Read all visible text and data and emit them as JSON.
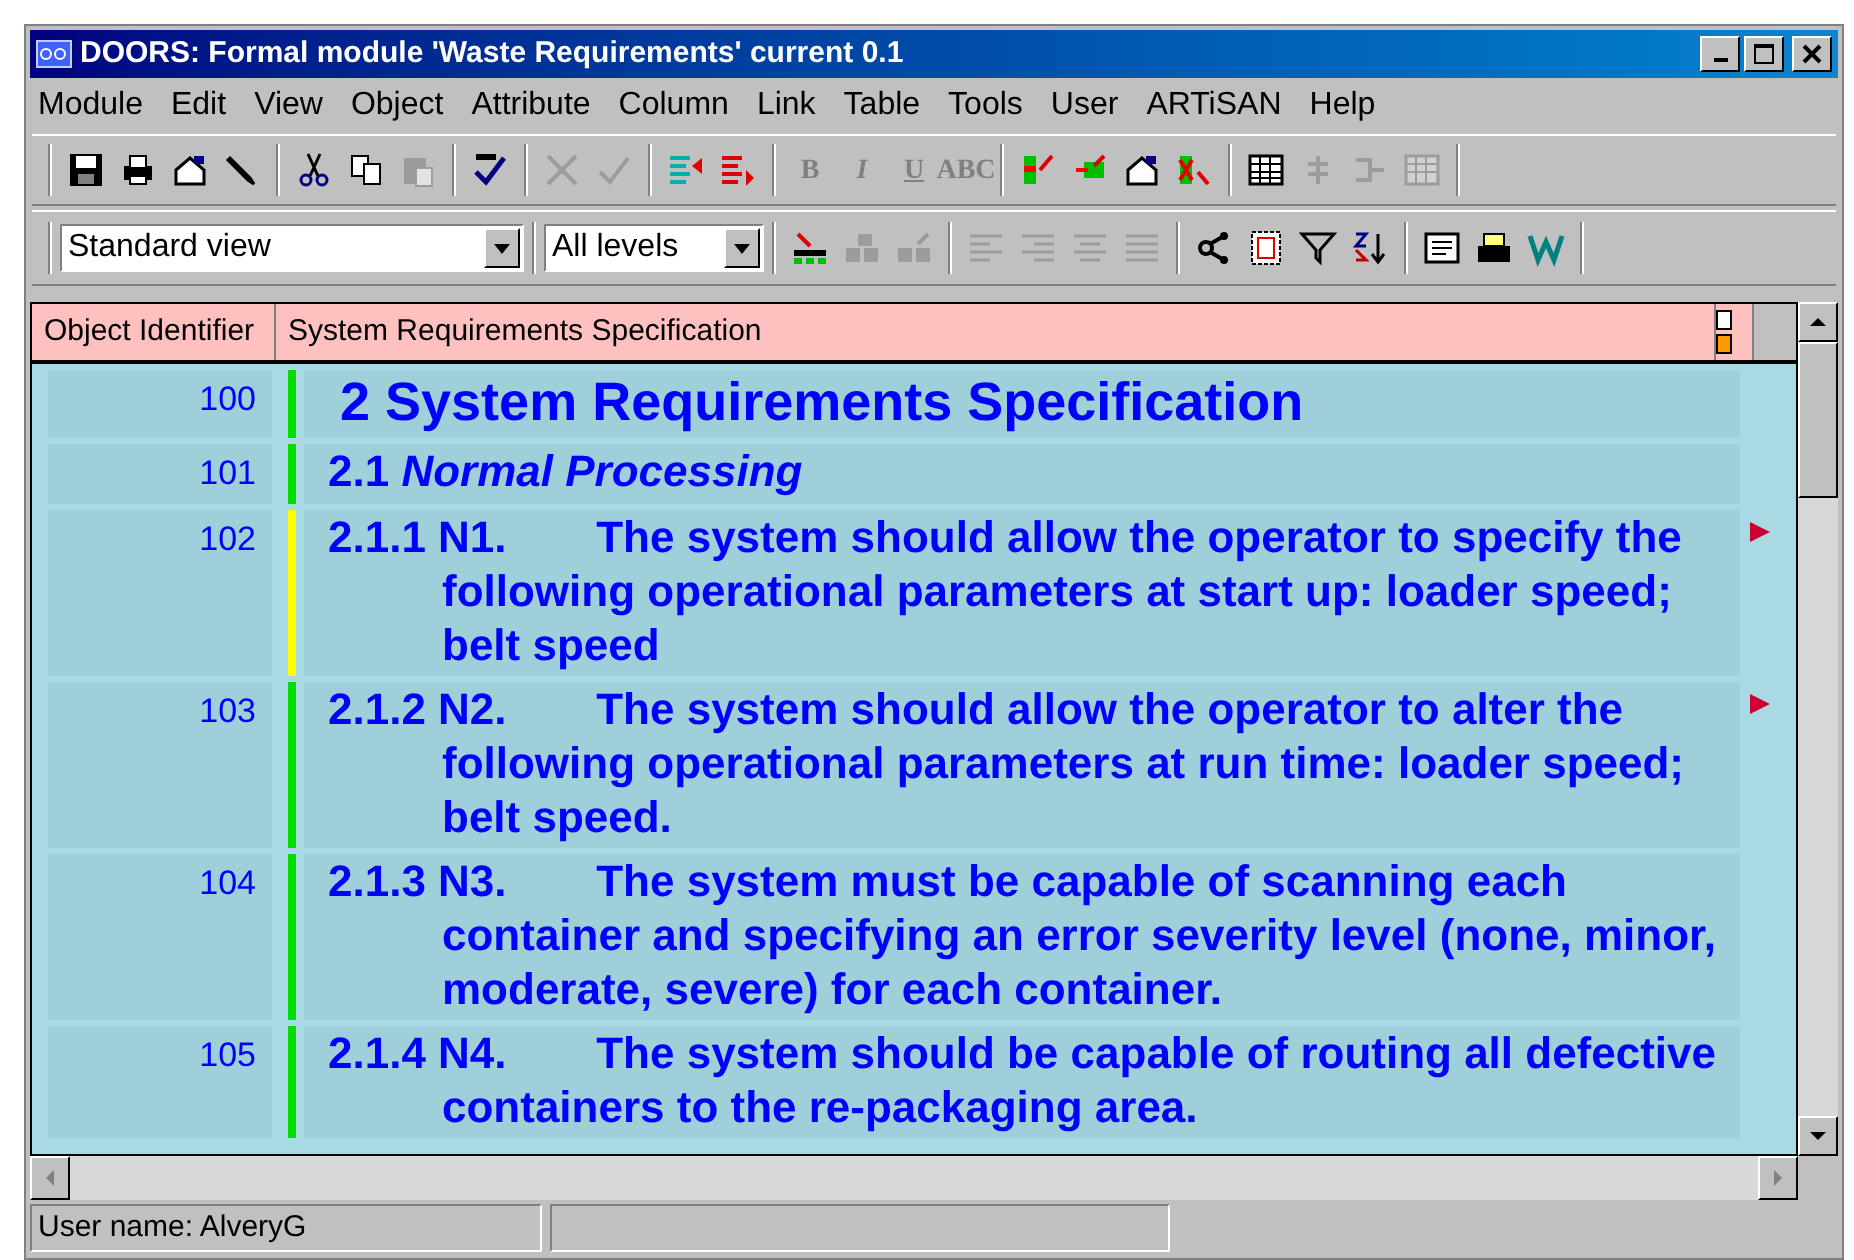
{
  "window": {
    "title": "DOORS: Formal module 'Waste Requirements' current 0.1"
  },
  "menu": [
    "Module",
    "Edit",
    "View",
    "Object",
    "Attribute",
    "Column",
    "Link",
    "Table",
    "Tools",
    "User",
    "ARTiSAN",
    "Help"
  ],
  "toolbar_1": [
    [
      {
        "disabled": false
      },
      {
        "disabled": false
      },
      {
        "disabled": false
      },
      {
        "disabled": false
      }
    ],
    [
      {
        "disabled": false
      },
      {
        "disabled": false
      },
      {
        "disabled": true
      }
    ],
    [
      {
        "disabled": false
      }
    ],
    [
      {
        "disabled": true
      },
      {
        "disabled": true
      }
    ],
    [
      {
        "disabled": false
      },
      {
        "disabled": false
      }
    ],
    [
      {
        "label": "B",
        "disabled": true
      },
      {
        "label": "I",
        "disabled": true
      },
      {
        "label": "U",
        "disabled": true
      },
      {
        "label": "ABC",
        "disabled": true
      }
    ],
    [
      {
        "disabled": false
      },
      {
        "disabled": false
      },
      {
        "disabled": false
      },
      {
        "disabled": false
      }
    ],
    [
      {
        "disabled": false
      },
      {
        "disabled": true
      },
      {
        "disabled": true
      },
      {
        "disabled": true
      }
    ]
  ],
  "view_select": {
    "value": "Standard view"
  },
  "level_select": {
    "value": "All levels"
  },
  "toolbar_2": [
    [
      {
        "disabled": false
      },
      {
        "disabled": true
      },
      {
        "disabled": true
      }
    ],
    [
      {
        "disabled": true
      },
      {
        "disabled": true
      },
      {
        "disabled": true
      },
      {
        "disabled": true
      }
    ],
    [
      {
        "disabled": false
      },
      {
        "disabled": false
      },
      {
        "disabled": false
      },
      {
        "disabled": false
      }
    ],
    [
      {
        "disabled": false
      },
      {
        "disabled": false
      },
      {
        "disabled": false
      }
    ]
  ],
  "table": {
    "columns": [
      "Object Identifier",
      "System Requirements Specification"
    ],
    "rows": [
      {
        "id": "100",
        "kind": "heading1",
        "text": "2 System Requirements Specification",
        "color": "#00dd00",
        "linked": false
      },
      {
        "id": "101",
        "kind": "heading2",
        "text": "2.1 *Normal Processing*",
        "color": "#00dd00",
        "linked": false
      },
      {
        "id": "102",
        "kind": "requirement",
        "number": "2.1.1 N1.",
        "text": "The system should allow the operator to specify the following operational parameters at start up: loader speed; belt speed",
        "color": "#ffff00",
        "linked": true
      },
      {
        "id": "103",
        "kind": "requirement",
        "number": "2.1.2 N2.",
        "text": "The system should allow the operator to alter the following operational parameters at run time: loader speed; belt speed.",
        "color": "#00dd00",
        "linked": true
      },
      {
        "id": "104",
        "kind": "requirement",
        "number": "2.1.3 N3.",
        "text": "The system must be capable of scanning each container and specifying an error severity level (none, minor, moderate, severe) for each container.",
        "color": "#00dd00",
        "linked": false
      },
      {
        "id": "105",
        "kind": "requirement",
        "number": "2.1.4 N4.",
        "text": "The system should be capable of routing all defective containers to the re-packaging area.",
        "color": "#00dd00",
        "linked": false
      }
    ]
  },
  "status_bar": [
    "User name: AlveryG"
  ]
}
